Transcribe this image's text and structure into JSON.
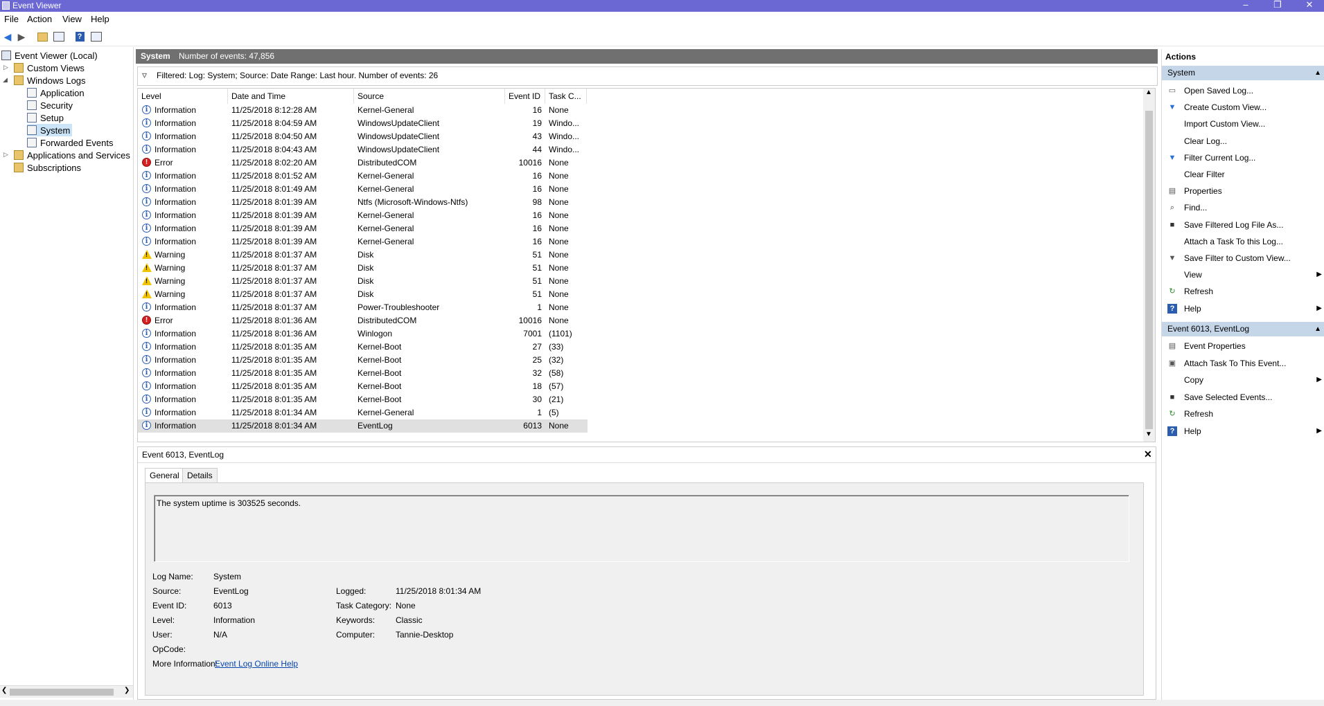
{
  "window": {
    "title": "Event Viewer"
  },
  "menu": [
    "File",
    "Action",
    "View",
    "Help"
  ],
  "tree": {
    "root": "Event Viewer (Local)",
    "custom_views": "Custom Views",
    "windows_logs": "Windows Logs",
    "logs": [
      "Application",
      "Security",
      "Setup",
      "System",
      "Forwarded Events"
    ],
    "apps_services": "Applications and Services Lo",
    "subscriptions": "Subscriptions"
  },
  "center": {
    "log_name": "System",
    "event_count": "Number of events: 47,856",
    "filter_text": "Filtered: Log: System; Source: Date Range: Last hour. Number of events: 26",
    "columns": [
      "Level",
      "Date and Time",
      "Source",
      "Event ID",
      "Task C..."
    ],
    "rows": [
      {
        "level": "Information",
        "type": "info",
        "date": "11/25/2018 8:12:28 AM",
        "source": "Kernel-General",
        "id": "16",
        "task": "None"
      },
      {
        "level": "Information",
        "type": "info",
        "date": "11/25/2018 8:04:59 AM",
        "source": "WindowsUpdateClient",
        "id": "19",
        "task": "Windo..."
      },
      {
        "level": "Information",
        "type": "info",
        "date": "11/25/2018 8:04:50 AM",
        "source": "WindowsUpdateClient",
        "id": "43",
        "task": "Windo..."
      },
      {
        "level": "Information",
        "type": "info",
        "date": "11/25/2018 8:04:43 AM",
        "source": "WindowsUpdateClient",
        "id": "44",
        "task": "Windo..."
      },
      {
        "level": "Error",
        "type": "error",
        "date": "11/25/2018 8:02:20 AM",
        "source": "DistributedCOM",
        "id": "10016",
        "task": "None"
      },
      {
        "level": "Information",
        "type": "info",
        "date": "11/25/2018 8:01:52 AM",
        "source": "Kernel-General",
        "id": "16",
        "task": "None"
      },
      {
        "level": "Information",
        "type": "info",
        "date": "11/25/2018 8:01:49 AM",
        "source": "Kernel-General",
        "id": "16",
        "task": "None"
      },
      {
        "level": "Information",
        "type": "info",
        "date": "11/25/2018 8:01:39 AM",
        "source": "Ntfs (Microsoft-Windows-Ntfs)",
        "id": "98",
        "task": "None"
      },
      {
        "level": "Information",
        "type": "info",
        "date": "11/25/2018 8:01:39 AM",
        "source": "Kernel-General",
        "id": "16",
        "task": "None"
      },
      {
        "level": "Information",
        "type": "info",
        "date": "11/25/2018 8:01:39 AM",
        "source": "Kernel-General",
        "id": "16",
        "task": "None"
      },
      {
        "level": "Information",
        "type": "info",
        "date": "11/25/2018 8:01:39 AM",
        "source": "Kernel-General",
        "id": "16",
        "task": "None"
      },
      {
        "level": "Warning",
        "type": "warn",
        "date": "11/25/2018 8:01:37 AM",
        "source": "Disk",
        "id": "51",
        "task": "None"
      },
      {
        "level": "Warning",
        "type": "warn",
        "date": "11/25/2018 8:01:37 AM",
        "source": "Disk",
        "id": "51",
        "task": "None"
      },
      {
        "level": "Warning",
        "type": "warn",
        "date": "11/25/2018 8:01:37 AM",
        "source": "Disk",
        "id": "51",
        "task": "None"
      },
      {
        "level": "Warning",
        "type": "warn",
        "date": "11/25/2018 8:01:37 AM",
        "source": "Disk",
        "id": "51",
        "task": "None"
      },
      {
        "level": "Information",
        "type": "info",
        "date": "11/25/2018 8:01:37 AM",
        "source": "Power-Troubleshooter",
        "id": "1",
        "task": "None"
      },
      {
        "level": "Error",
        "type": "error",
        "date": "11/25/2018 8:01:36 AM",
        "source": "DistributedCOM",
        "id": "10016",
        "task": "None"
      },
      {
        "level": "Information",
        "type": "info",
        "date": "11/25/2018 8:01:36 AM",
        "source": "Winlogon",
        "id": "7001",
        "task": "(1101)"
      },
      {
        "level": "Information",
        "type": "info",
        "date": "11/25/2018 8:01:35 AM",
        "source": "Kernel-Boot",
        "id": "27",
        "task": "(33)"
      },
      {
        "level": "Information",
        "type": "info",
        "date": "11/25/2018 8:01:35 AM",
        "source": "Kernel-Boot",
        "id": "25",
        "task": "(32)"
      },
      {
        "level": "Information",
        "type": "info",
        "date": "11/25/2018 8:01:35 AM",
        "source": "Kernel-Boot",
        "id": "32",
        "task": "(58)"
      },
      {
        "level": "Information",
        "type": "info",
        "date": "11/25/2018 8:01:35 AM",
        "source": "Kernel-Boot",
        "id": "18",
        "task": "(57)"
      },
      {
        "level": "Information",
        "type": "info",
        "date": "11/25/2018 8:01:35 AM",
        "source": "Kernel-Boot",
        "id": "30",
        "task": "(21)"
      },
      {
        "level": "Information",
        "type": "info",
        "date": "11/25/2018 8:01:34 AM",
        "source": "Kernel-General",
        "id": "1",
        "task": "(5)"
      },
      {
        "level": "Information",
        "type": "info",
        "date": "11/25/2018 8:01:34 AM",
        "source": "EventLog",
        "id": "6013",
        "task": "None",
        "selected": true
      }
    ]
  },
  "detail": {
    "title": "Event 6013, EventLog",
    "tabs": [
      "General",
      "Details"
    ],
    "description": "The system uptime is 303525 seconds.",
    "labels": {
      "log_name": "Log Name:",
      "source": "Source:",
      "event_id": "Event ID:",
      "level": "Level:",
      "user": "User:",
      "opcode": "OpCode:",
      "more_info": "More Information:",
      "logged": "Logged:",
      "task_category": "Task Category:",
      "keywords": "Keywords:",
      "computer": "Computer:"
    },
    "values": {
      "log_name": "System",
      "source": "EventLog",
      "event_id": "6013",
      "level": "Information",
      "user": "N/A",
      "opcode": "",
      "more_info_link": "Event Log Online Help",
      "logged": "11/25/2018 8:01:34 AM",
      "task_category": "None",
      "keywords": "Classic",
      "computer": "Tannie-Desktop"
    }
  },
  "actions": {
    "title": "Actions",
    "section1": "System",
    "items1": [
      "Open Saved Log...",
      "Create Custom View...",
      "Import Custom View...",
      "Clear Log...",
      "Filter Current Log...",
      "Clear Filter",
      "Properties",
      "Find...",
      "Save Filtered Log File As...",
      "Attach a Task To this Log...",
      "Save Filter to Custom View...",
      "View",
      "Refresh",
      "Help"
    ],
    "section2": "Event 6013, EventLog",
    "items2": [
      "Event Properties",
      "Attach Task To This Event...",
      "Copy",
      "Save Selected Events...",
      "Refresh",
      "Help"
    ]
  }
}
